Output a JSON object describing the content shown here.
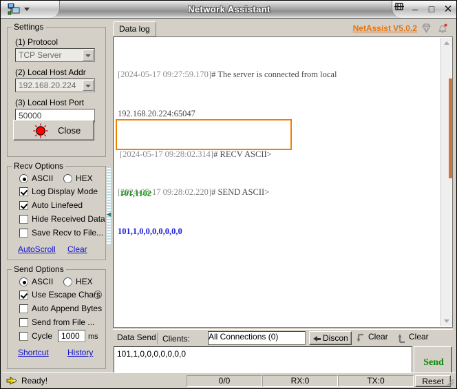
{
  "window": {
    "title": "Network Assistant",
    "app_icon": "network-app-icon",
    "menu_caret": "dropdown-caret",
    "pin": "⚐",
    "minimize": "–",
    "maximize": "□",
    "close": "✕"
  },
  "sidebar": {
    "settings": {
      "legend": "Settings",
      "protocol_label": "(1) Protocol",
      "protocol_value": "TCP Server",
      "host_addr_label": "(2) Local Host Addr",
      "host_addr_value": "192.168.20.224",
      "host_port_label": "(3) Local Host Port",
      "host_port_value": "50000",
      "close_button": "Close"
    },
    "recv_options": {
      "legend": "Recv Options",
      "ascii": {
        "label": "ASCII",
        "checked": true
      },
      "hex": {
        "label": "HEX",
        "checked": false
      },
      "checkboxes": [
        {
          "label": "Log Display Mode",
          "checked": true
        },
        {
          "label": "Auto Linefeed",
          "checked": true
        },
        {
          "label": "Hide Received Data",
          "checked": false
        },
        {
          "label": "Save Recv to File...",
          "checked": false
        }
      ],
      "links": [
        "AutoScroll",
        "Clear"
      ]
    },
    "send_options": {
      "legend": "Send Options",
      "ascii": {
        "label": "ASCII",
        "checked": true
      },
      "hex": {
        "label": "HEX",
        "checked": false
      },
      "checkboxes": [
        {
          "label": "Use Escape Chars",
          "checked": true,
          "info": "i"
        },
        {
          "label": "Auto Append Bytes",
          "checked": false
        },
        {
          "label": "Send from File ...",
          "checked": false
        }
      ],
      "cycle": {
        "label": "Cycle",
        "value": "1000",
        "unit": "ms",
        "checked": false
      },
      "links": [
        "Shortcut",
        "History"
      ]
    }
  },
  "main": {
    "tab_label": "Data log",
    "version_link": "NetAssist V5.0.2",
    "diamond_icon": "diamond-icon",
    "bell_icon": "bell-notification-icon",
    "log": {
      "entry1_ts": "[2024-05-17 09:27:59.170]",
      "entry1_hdr": "# The server is connected from local",
      "entry1_body": "192.168.20.224:65047",
      "entry2_ts": "[2024-05-17 09:28:02.220]",
      "entry2_hdr": "# SEND ASCII>",
      "entry2_body": "101,1,0,0,0,0,0,0,0",
      "entry3_ts": "[2024-05-17 09:28:02.314]",
      "entry3_hdr": "# RECV ASCII>",
      "entry3_body": "101,1102"
    }
  },
  "send_panel": {
    "tab_label": "Data Send",
    "clients_label": "Clients:",
    "connection_value": "All Connections (0)",
    "disconnect_label": "Discon",
    "clear_recv_label": "Clear",
    "clear_send_label": "Clear",
    "input_value": "101,1,0,0,0,0,0,0,0",
    "send_button": "Send"
  },
  "status_bar": {
    "ready_text": "Ready!",
    "hand_icon": "pointing-hand-icon",
    "counter": "0/0",
    "rx": "RX:0",
    "tx": "TX:0",
    "reset_button": "Reset"
  },
  "colors": {
    "accent_orange": "#e8730b",
    "highlight_box": "#f08000",
    "send_data": "#2222dd",
    "recv_data": "#12a012",
    "send_button_text": "#0b8a0b",
    "link_blue": "#1111cc",
    "window_face": "#d4d0c8"
  }
}
